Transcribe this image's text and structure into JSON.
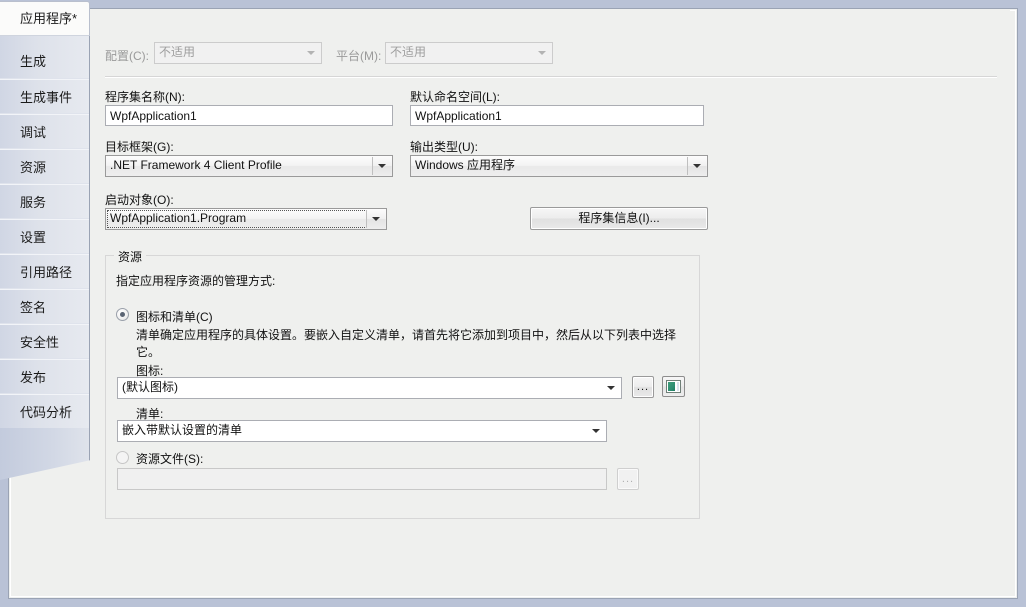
{
  "sidebar": {
    "selected_tab": "应用程序*",
    "items": [
      {
        "label": "生成"
      },
      {
        "label": "生成事件"
      },
      {
        "label": "调试"
      },
      {
        "label": "资源"
      },
      {
        "label": "服务"
      },
      {
        "label": "设置"
      },
      {
        "label": "引用路径"
      },
      {
        "label": "签名"
      },
      {
        "label": "安全性"
      },
      {
        "label": "发布"
      },
      {
        "label": "代码分析"
      }
    ]
  },
  "toolbar": {
    "configuration_label": "配置(C):",
    "configuration_value": "不适用",
    "platform_label": "平台(M):",
    "platform_value": "不适用"
  },
  "form": {
    "assembly_name_label": "程序集名称(N):",
    "assembly_name_value": "WpfApplication1",
    "default_namespace_label": "默认命名空间(L):",
    "default_namespace_value": "WpfApplication1",
    "target_framework_label": "目标框架(G):",
    "target_framework_value": ".NET Framework 4 Client Profile",
    "output_type_label": "输出类型(U):",
    "output_type_value": "Windows 应用程序",
    "startup_object_label": "启动对象(O):",
    "startup_object_value": "WpfApplication1.Program",
    "assembly_info_button": "程序集信息(I)..."
  },
  "resources": {
    "group_title": "资源",
    "description": "指定应用程序资源的管理方式:",
    "icon_manifest_radio_label": "图标和清单(C)",
    "icon_manifest_help": "清单确定应用程序的具体设置。要嵌入自定义清单，请首先将它添加到项目中，然后从以下列表中选择它。",
    "icon_label": "图标:",
    "icon_value": "(默认图标)",
    "manifest_label": "清单:",
    "manifest_value": "嵌入带默认设置的清单",
    "resource_file_radio_label": "资源文件(S):",
    "resource_file_value": "",
    "browse_button": "...",
    "icon_manifest_selected": true,
    "resource_file_selected": false
  },
  "colors": {
    "page_background": "#b9c2d6",
    "pane_background": "#eff0ee",
    "tab_selected_background": "#fbfbfa",
    "icon_accent": "#2f8f72"
  }
}
